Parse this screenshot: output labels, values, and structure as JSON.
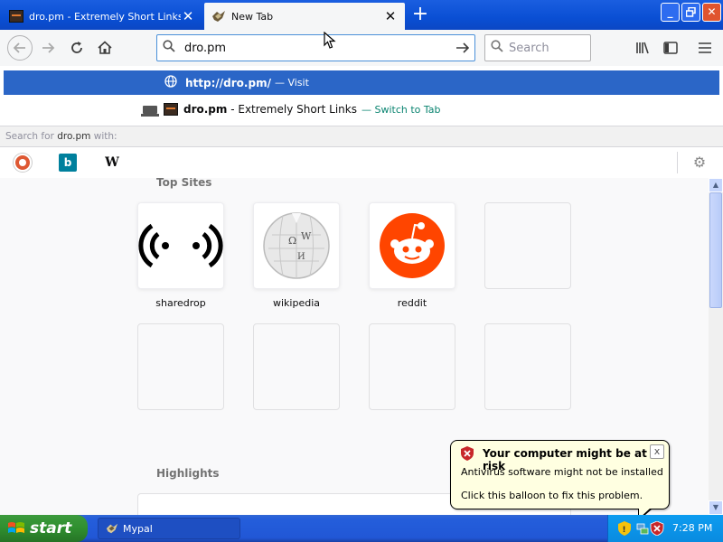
{
  "browser": {
    "tabs": [
      {
        "label": "dro.pm - Extremely Short Links",
        "close": "✕"
      },
      {
        "label": "New Tab",
        "close": "✕"
      }
    ],
    "new_tab_icon": "plus-icon",
    "window_buttons": {
      "minimize": "_",
      "maximize": "▫",
      "close": "✕"
    },
    "url_value": "dro.pm",
    "search_placeholder": "Search"
  },
  "autocomplete": {
    "row1": {
      "url": "http://dro.pm/",
      "action": "— Visit"
    },
    "row2": {
      "title": "dro.pm",
      "subtitle": " - Extremely Short Links",
      "dash": "—",
      "action": "Switch to Tab"
    },
    "search_for_prefix": "Search for ",
    "search_for_term": "dro.pm",
    "search_for_suffix": " with:",
    "engines": [
      "duckduckgo",
      "bing",
      "wikipedia"
    ],
    "bing_letter": "b",
    "wiki_letter": "W"
  },
  "newtab": {
    "topsites_heading": "Top Sites",
    "sites": [
      {
        "label": "sharedrop"
      },
      {
        "label": "wikipedia"
      },
      {
        "label": "reddit"
      }
    ],
    "highlights_heading": "Highlights"
  },
  "balloon": {
    "title": "Your computer might be at risk",
    "line1": "Antivirus software might not be installed",
    "line2": "Click this balloon to fix this problem.",
    "close": "x"
  },
  "taskbar": {
    "start_label": "start",
    "task_label": "Mypal",
    "clock": "7:28 PM"
  },
  "colors": {
    "titlebar": "#0a4fd4",
    "selected_row": "#2b66c7",
    "switch_to_tab": "#0a8470",
    "balloon_bg": "#ffffe1",
    "reddit": "#ff4500"
  }
}
